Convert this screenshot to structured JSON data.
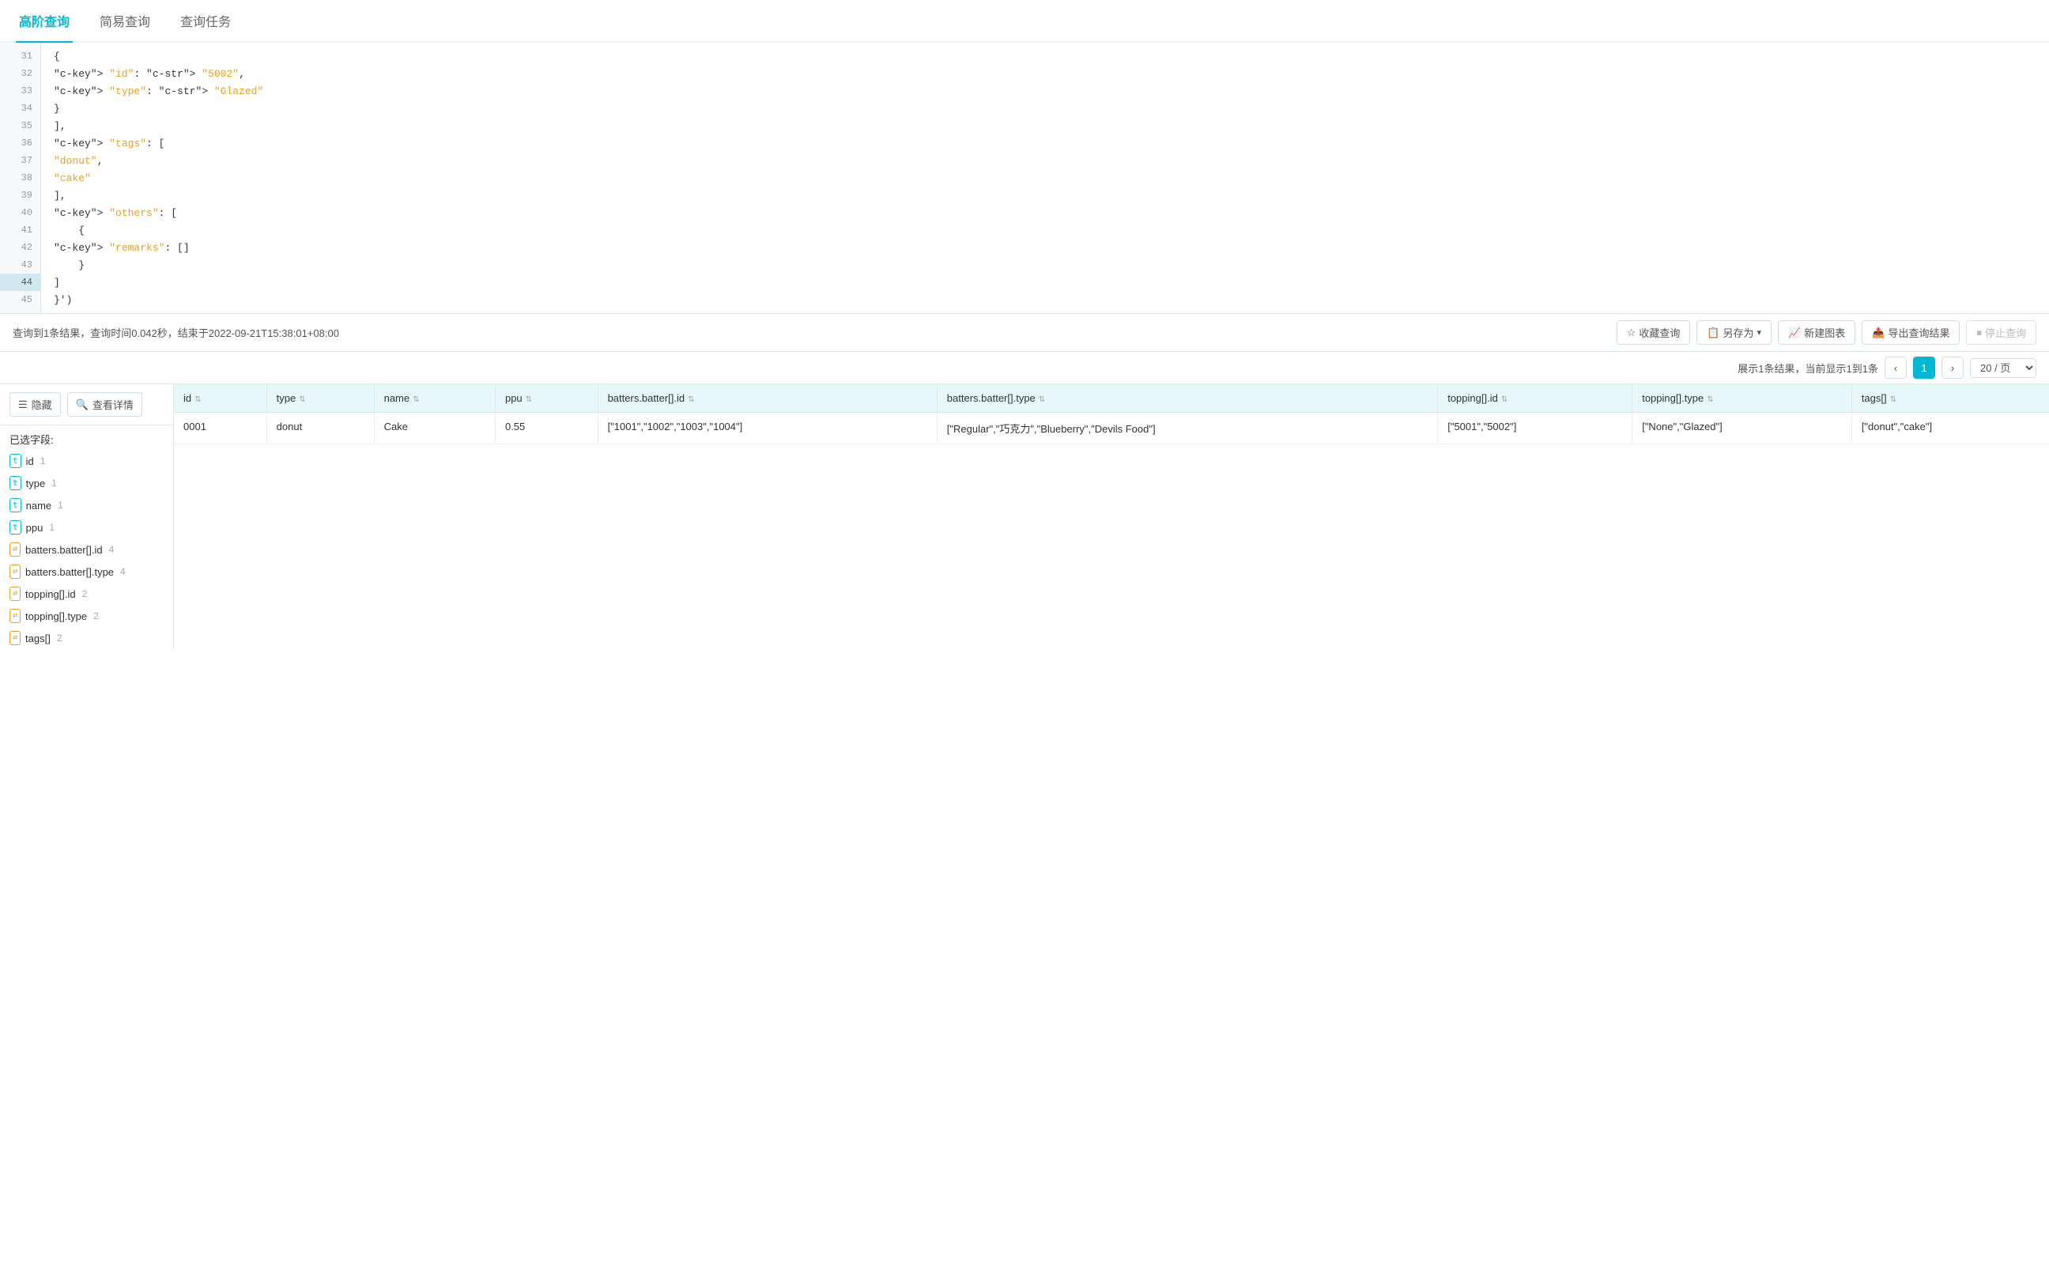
{
  "tabs": [
    {
      "id": "advanced",
      "label": "高阶查询",
      "active": true
    },
    {
      "id": "simple",
      "label": "简易查询",
      "active": false
    },
    {
      "id": "task",
      "label": "查询任务",
      "active": false
    }
  ],
  "editor": {
    "lines": [
      {
        "num": 31,
        "content": "{",
        "highlighted": false
      },
      {
        "num": 32,
        "content": "    \"id\": \"5002\",",
        "highlighted": false
      },
      {
        "num": 33,
        "content": "    \"type\": \"Glazed\"",
        "highlighted": false
      },
      {
        "num": 34,
        "content": "}",
        "highlighted": false
      },
      {
        "num": 35,
        "content": "],",
        "highlighted": false
      },
      {
        "num": 36,
        "content": "\"tags\": [",
        "highlighted": false
      },
      {
        "num": 37,
        "content": "    \"donut\",",
        "highlighted": false
      },
      {
        "num": 38,
        "content": "    \"cake\"",
        "highlighted": false
      },
      {
        "num": 39,
        "content": "],",
        "highlighted": false
      },
      {
        "num": 40,
        "content": "\"others\": [",
        "highlighted": false
      },
      {
        "num": 41,
        "content": "    {",
        "highlighted": false
      },
      {
        "num": 42,
        "content": "        \"remarks\": []",
        "highlighted": false
      },
      {
        "num": 43,
        "content": "    }",
        "highlighted": false
      },
      {
        "num": 44,
        "content": "]",
        "highlighted": true
      },
      {
        "num": 45,
        "content": "}')",
        "highlighted": false
      }
    ]
  },
  "result_bar": {
    "summary": "查询到1条结果，查询时间0.042秒，结束于2022-09-21T15:38:01+08:00",
    "actions": [
      {
        "id": "favorite",
        "label": "收藏查询",
        "icon": "☆"
      },
      {
        "id": "save-as",
        "label": "另存为",
        "icon": "📋",
        "dropdown": true
      },
      {
        "id": "new-chart",
        "label": "新建图表",
        "icon": "📈"
      },
      {
        "id": "export",
        "label": "导出查询结果",
        "icon": "📤"
      },
      {
        "id": "stop",
        "label": "停止查询",
        "icon": "⏹",
        "disabled": true
      }
    ]
  },
  "pagination": {
    "summary": "展示1条结果，当前显示1到1条",
    "current_page": 1,
    "page_size_label": "20 / 页"
  },
  "fields_sidebar": {
    "hide_btn": "隐藏",
    "view_details_btn": "查看详情",
    "fields_label": "已选字段:",
    "fields": [
      {
        "type": "t",
        "name": "id",
        "count": 1,
        "array": false
      },
      {
        "type": "t",
        "name": "type",
        "count": 1,
        "array": false
      },
      {
        "type": "t",
        "name": "name",
        "count": 1,
        "array": false
      },
      {
        "type": "t",
        "name": "ppu",
        "count": 1,
        "array": false
      },
      {
        "type": "⇄",
        "name": "batters.batter[].id",
        "count": 4,
        "array": true
      },
      {
        "type": "⇄",
        "name": "batters.batter[].type",
        "count": 4,
        "array": true
      },
      {
        "type": "⇄",
        "name": "topping[].id",
        "count": 2,
        "array": true
      },
      {
        "type": "⇄",
        "name": "topping[].type",
        "count": 2,
        "array": true
      },
      {
        "type": "⇄",
        "name": "tags[]",
        "count": 2,
        "array": true
      }
    ]
  },
  "table": {
    "columns": [
      {
        "key": "id",
        "label": "id"
      },
      {
        "key": "type",
        "label": "type"
      },
      {
        "key": "name",
        "label": "name"
      },
      {
        "key": "ppu",
        "label": "ppu"
      },
      {
        "key": "batters_id",
        "label": "batters.batter[].id"
      },
      {
        "key": "batters_type",
        "label": "batters.batter[].type"
      },
      {
        "key": "topping_id",
        "label": "topping[].id"
      },
      {
        "key": "topping_type",
        "label": "topping[].type"
      },
      {
        "key": "tags",
        "label": "tags[]"
      }
    ],
    "rows": [
      {
        "id": "0001",
        "type": "donut",
        "name": "Cake",
        "ppu": "0.55",
        "batters_id": "[\"1001\",\"1002\",\"1003\",\"1004\"]",
        "batters_type": "[\"Regular\",\"巧克力\",\"Blueberry\",\"Devils Food\"]",
        "topping_id": "[\"5001\",\"5002\"]",
        "topping_type": "[\"None\",\"Glazed\"]",
        "tags": "[\"donut\",\"cake\"]"
      }
    ]
  }
}
